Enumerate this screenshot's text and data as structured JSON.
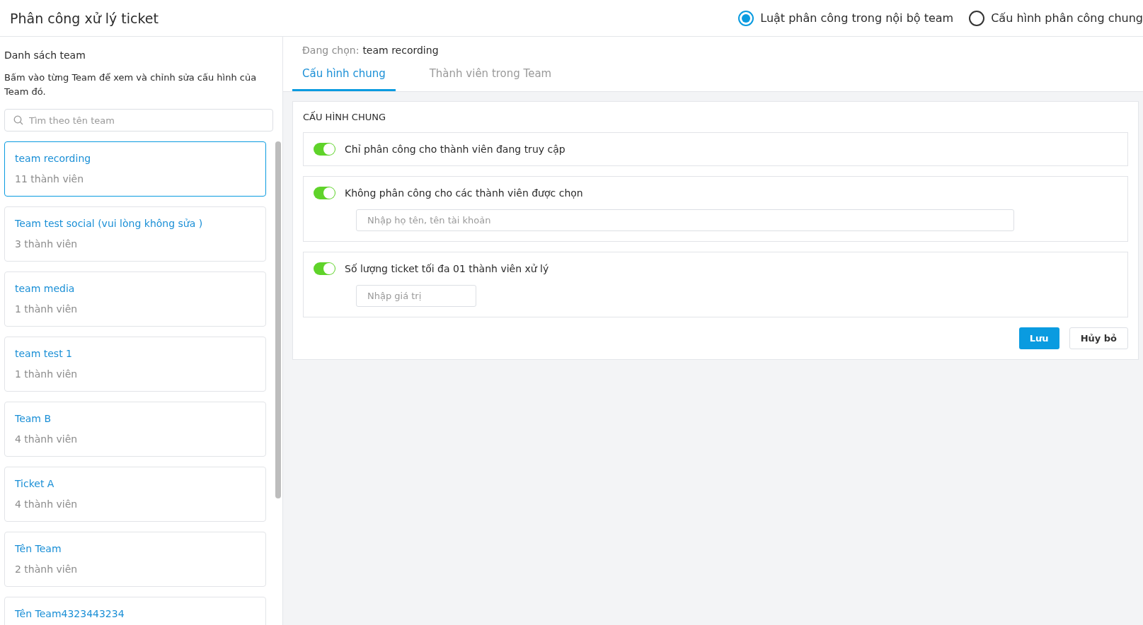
{
  "title": "Phân công xử lý ticket",
  "modes": [
    {
      "label": "Luật phân công trong nội bộ team",
      "selected": true
    },
    {
      "label": "Cấu hình phân công chung",
      "selected": false
    }
  ],
  "sidebar": {
    "heading": "Danh sách team",
    "hint": "Bấm vào từng Team để xem và chỉnh sửa cấu hình của Team đó.",
    "search": {
      "placeholder": "Tìm theo tên team"
    },
    "teams": [
      {
        "name": "team recording",
        "members": "11 thành viên",
        "selected": true
      },
      {
        "name": "Team test social (vui lòng không sửa )",
        "members": "3 thành viên",
        "selected": false
      },
      {
        "name": "team media",
        "members": "1 thành viên",
        "selected": false
      },
      {
        "name": "team test 1",
        "members": "1 thành viên",
        "selected": false
      },
      {
        "name": "Team B",
        "members": "4 thành viên",
        "selected": false
      },
      {
        "name": "Ticket A",
        "members": "4 thành viên",
        "selected": false
      },
      {
        "name": "Tên Team",
        "members": "2 thành viên",
        "selected": false
      },
      {
        "name": "Tên Team4323443234",
        "selected": false
      }
    ]
  },
  "current": {
    "label": "Đang chọn:",
    "value": "team recording"
  },
  "tabs": [
    {
      "label": "Cấu hình chung",
      "selected": true
    },
    {
      "label": "Thành viên trong Team",
      "selected": false
    }
  ],
  "panel": {
    "heading": "CẤU HÌNH CHUNG",
    "settings": [
      {
        "kind": "plain",
        "label": "Chỉ phân công cho thành viên đang truy cập",
        "on": true
      },
      {
        "kind": "text",
        "label": "Không phân công cho các thành viên được chọn",
        "on": true,
        "placeholder": "Nhập họ tên, tên tài khoản"
      },
      {
        "kind": "number",
        "label": "Số lượng ticket tối đa 01 thành viên xử lý",
        "on": true,
        "placeholder": "Nhập giá trị"
      }
    ],
    "buttons": {
      "save": "Lưu",
      "cancel": "Hủy bỏ"
    }
  }
}
